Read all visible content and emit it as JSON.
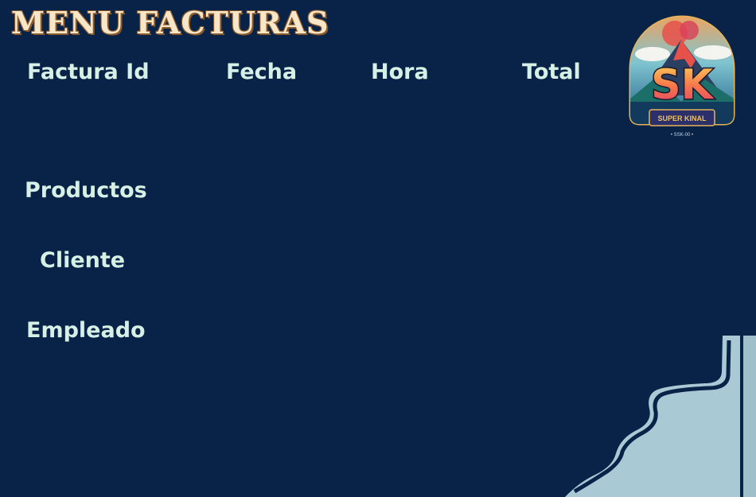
{
  "header": {
    "title": "MENU FACTURAS"
  },
  "table_headers": {
    "factura_id": "Factura Id",
    "fecha": "Fecha",
    "hora": "Hora",
    "total": "Total"
  },
  "side_labels": {
    "productos": "Productos",
    "cliente": "Cliente",
    "empleado": "Empleado"
  },
  "logo": {
    "letters": "SK",
    "name": "SUPER KINAL",
    "tagline": "• SSK-00 •"
  },
  "colors": {
    "background": "#082248",
    "label": "#d7f0e6",
    "title": "#f7e6c7",
    "wave": "#a9cad4"
  }
}
